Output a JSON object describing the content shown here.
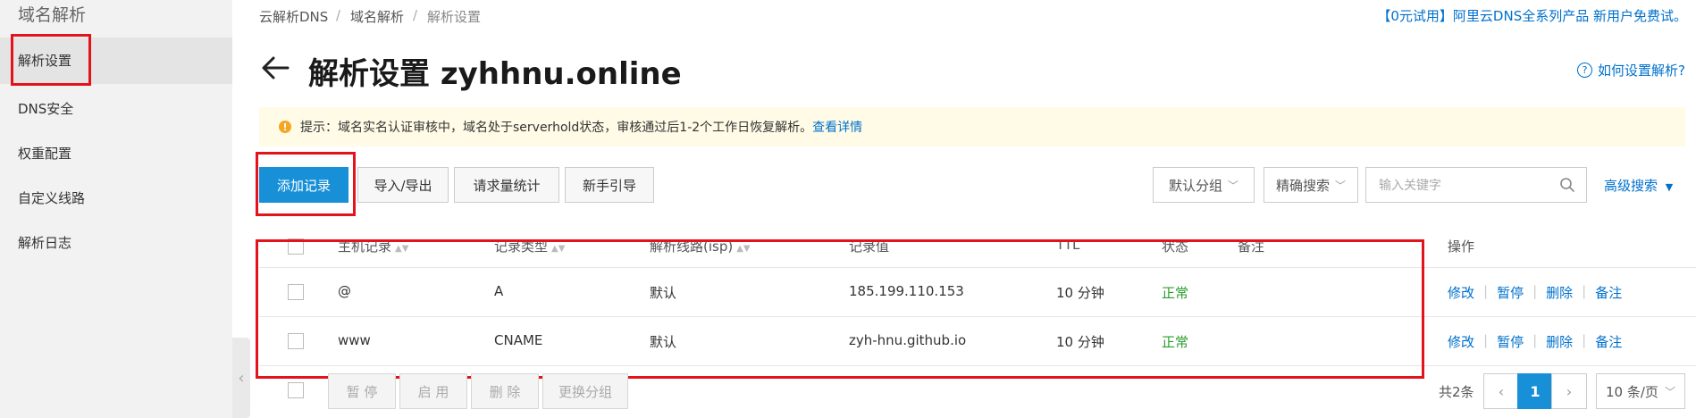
{
  "sidebar": {
    "title": "域名解析",
    "items": [
      {
        "label": "解析设置",
        "active": true
      },
      {
        "label": "DNS安全",
        "active": false
      },
      {
        "label": "权重配置",
        "active": false
      },
      {
        "label": "自定义线路",
        "active": false
      },
      {
        "label": "解析日志",
        "active": false
      }
    ]
  },
  "breadcrumb": [
    "云解析DNS",
    "域名解析",
    "解析设置"
  ],
  "breadcrumb_sep": "/",
  "promo": "【0元试用】阿里云DNS全系列产品 新用户免费试。",
  "page": {
    "title": "解析设置 zyhhnu.online",
    "help": "如何设置解析?"
  },
  "notice": {
    "text": "提示：域名实名认证审核中，域名处于serverhold状态，审核通过后1-2个工作日恢复解析。",
    "link": "查看详情"
  },
  "toolbar": {
    "add": "添加记录",
    "import_export": "导入/导出",
    "stats": "请求量统计",
    "guide": "新手引导",
    "group_select": "默认分组",
    "search_mode": "精确搜索",
    "search_placeholder": "输入关键字",
    "advanced": "高级搜索"
  },
  "table": {
    "headers": {
      "host": "主机记录",
      "type": "记录类型",
      "line": "解析线路(isp)",
      "value": "记录值",
      "ttl": "TTL",
      "status": "状态",
      "remark": "备注",
      "ops": "操作"
    },
    "rows": [
      {
        "host": "@",
        "type": "A",
        "line": "默认",
        "value": "185.199.110.153",
        "ttl": "10 分钟",
        "status": "正常"
      },
      {
        "host": "www",
        "type": "CNAME",
        "line": "默认",
        "value": "zyh-hnu.github.io",
        "ttl": "10 分钟",
        "status": "正常"
      }
    ],
    "ops": {
      "edit": "修改",
      "pause": "暂停",
      "delete": "删除",
      "remark": "备注"
    }
  },
  "bottom": {
    "pause": "暂 停",
    "enable": "启 用",
    "delete": "删 除",
    "change_group": "更换分组",
    "total": "共2条",
    "current_page": "1",
    "page_size": "10 条/页"
  },
  "colors": {
    "accent": "#1890d8",
    "link": "#0070cc",
    "highlight": "#e3131b",
    "ok": "#2a9d2a"
  }
}
